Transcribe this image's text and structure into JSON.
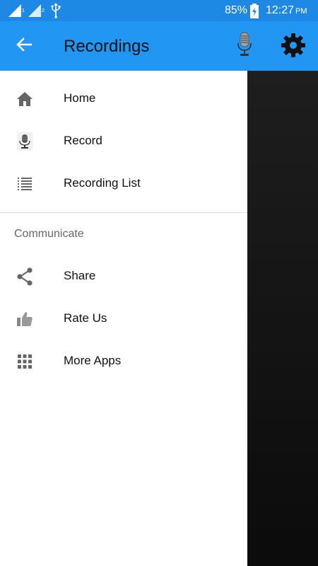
{
  "status_bar": {
    "battery": "85%",
    "time": "12:27",
    "ampm": "PM",
    "sim1": "1",
    "sim2": "2"
  },
  "app_bar": {
    "title": "Recordings",
    "back_icon": "arrow-left-icon",
    "mic_icon": "microphone-icon",
    "settings_icon": "gear-icon",
    "color": "#2196F3"
  },
  "drawer": {
    "main_items": [
      {
        "label": "Home",
        "icon": "home-icon"
      },
      {
        "label": "Record",
        "icon": "microphone-icon"
      },
      {
        "label": "Recording List",
        "icon": "list-icon"
      }
    ],
    "section_title": "Communicate",
    "communicate_items": [
      {
        "label": "Share",
        "icon": "share-icon"
      },
      {
        "label": "Rate Us",
        "icon": "thumbs-up-icon"
      },
      {
        "label": "More Apps",
        "icon": "grid-icon"
      }
    ]
  }
}
